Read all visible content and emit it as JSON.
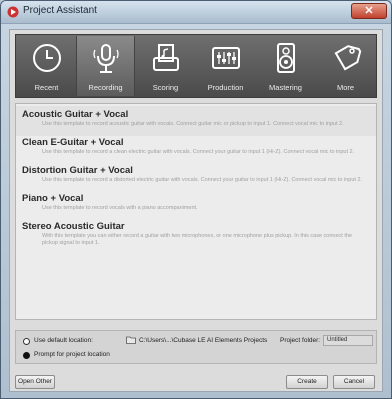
{
  "window": {
    "title": "Project Assistant",
    "close_glyph": "✕"
  },
  "tabs": [
    {
      "label": "Recent",
      "icon": "clock-icon"
    },
    {
      "label": "Recording",
      "icon": "microphone-icon",
      "active": true
    },
    {
      "label": "Scoring",
      "icon": "score-printer-icon"
    },
    {
      "label": "Production",
      "icon": "mixer-faders-icon"
    },
    {
      "label": "Mastering",
      "icon": "speaker-icon"
    },
    {
      "label": "More",
      "icon": "tag-icon"
    }
  ],
  "templates": [
    {
      "name": "Acoustic Guitar + Vocal",
      "description": "Use this template to record acoustic guitar with vocals. Connect guitar mic or pickup to input 1. Connect vocal mic to input 2."
    },
    {
      "name": "Clean E-Guitar + Vocal",
      "description": "Use this template to record a clean electric guitar with vocals. Connect your guitar to input 1 (Hi-Z). Connect vocal mic to input 2."
    },
    {
      "name": "Distortion Guitar + Vocal",
      "description": "Use this template to record a distorted electric guitar with vocals. Connect your guitar to input 1 (Hi-Z). Connect vocal mic to input 2."
    },
    {
      "name": "Piano + Vocal",
      "description": "Use this template to record vocals with a piano accompaniment."
    },
    {
      "name": "Stereo Acoustic Guitar",
      "description": "With this template you can either record a guitar with two microphones, or one microphone plus pickup. In this case connect the pickup signal to input 1."
    }
  ],
  "location": {
    "use_default_label": "Use default location:",
    "path": "C:\\Users\\...\\Cubase LE AI Elements Projects",
    "folder_label": "Project folder:",
    "folder_value": "Untitled",
    "prompt_label": "Prompt for project location"
  },
  "buttons": {
    "open_other": "Open Other",
    "create": "Create",
    "cancel": "Cancel"
  },
  "colors": {
    "tab_bar": "#5a5a5a",
    "list_bg": "#ececec",
    "title_bar": "#c2d2e2",
    "close_button": "#c0412c"
  }
}
